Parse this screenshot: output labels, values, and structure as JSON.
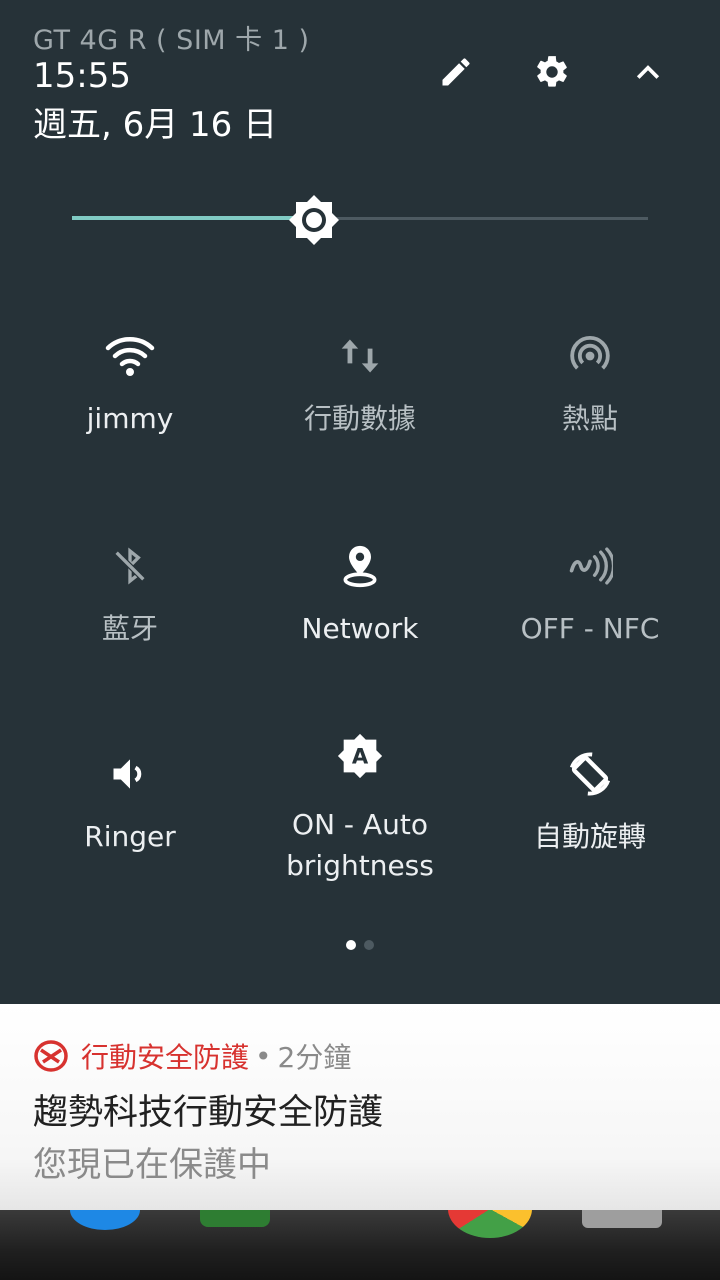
{
  "status": {
    "carrier": "GT 4G R ( SIM 卡 1 )",
    "time": "15:55",
    "date": "週五, 6月 16 日"
  },
  "header_icons": [
    "edit-icon",
    "settings-gear-icon",
    "collapse-chevron-icon"
  ],
  "brightness": {
    "level": 0.42,
    "track_color": "#4d5a61",
    "fill_color": "#80cbc4"
  },
  "tiles": [
    {
      "label": "jimmy",
      "icon": "wifi-icon",
      "state": "on"
    },
    {
      "label": "行動數據",
      "icon": "mobile-data-icon",
      "state": "off"
    },
    {
      "label": "熱點",
      "icon": "hotspot-icon",
      "state": "off"
    },
    {
      "label": "藍牙",
      "icon": "bluetooth-off-icon",
      "state": "off"
    },
    {
      "label": "Network",
      "icon": "location-icon",
      "state": "on"
    },
    {
      "label": "OFF - NFC",
      "icon": "nfc-icon",
      "state": "off"
    },
    {
      "label": "Ringer",
      "icon": "volume-icon",
      "state": "on"
    },
    {
      "label": "ON - Auto brightness",
      "icon": "auto-brightness-icon",
      "state": "on"
    },
    {
      "label": "自動旋轉",
      "icon": "auto-rotate-icon",
      "state": "on"
    }
  ],
  "pager": {
    "pages": 2,
    "current": 1
  },
  "notification": {
    "app_name": "行動安全防護",
    "separator": "•",
    "age": "2分鐘",
    "title": "趨勢科技行動安全防護",
    "text": "您現已在保護中",
    "accent": "#d7322f"
  }
}
